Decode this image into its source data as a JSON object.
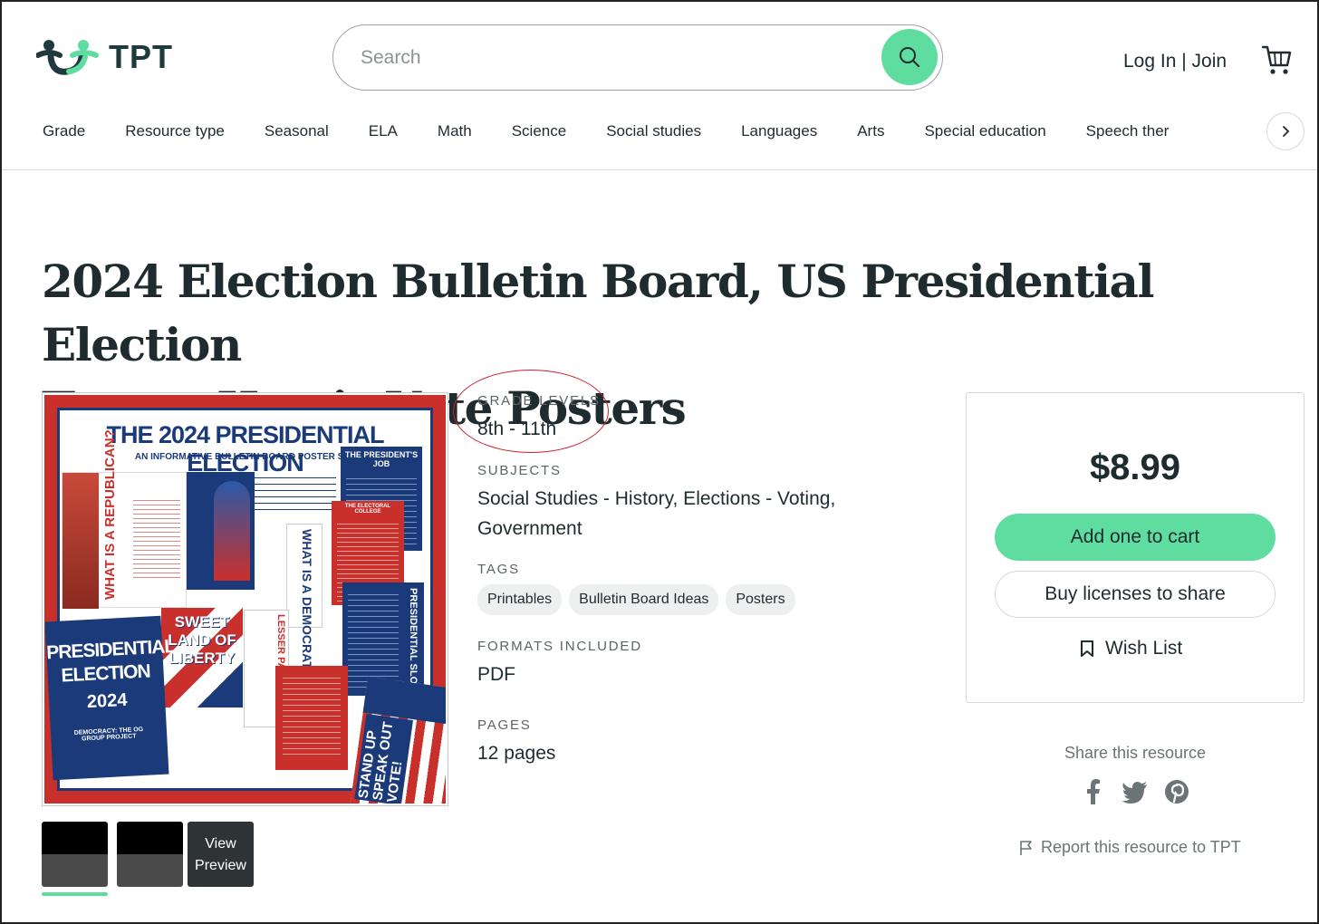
{
  "header": {
    "logo_text": "TPT",
    "search_placeholder": "Search",
    "login_label": "Log In",
    "separator": " | ",
    "join_label": "Join"
  },
  "nav": {
    "items": [
      "Grade",
      "Resource type",
      "Seasonal",
      "ELA",
      "Math",
      "Science",
      "Social studies",
      "Languages",
      "Arts",
      "Special education",
      "Speech ther"
    ]
  },
  "product": {
    "title_line1": "2024 Election Bulletin Board, US Presidential Election",
    "title_line2": "Trump Harris Vote Posters",
    "image": {
      "main_title": "THE 2024 PRESIDENTIAL ELECTION",
      "subtitle": "AN INFORMATIVE BULLETIN BOARD POSTER SET",
      "republican": "WHAT IS A REPUBLICAN?",
      "democrat": "WHAT IS A DEMOCRAT?",
      "presidents_job": "THE PRESIDENT'S JOB",
      "electoral_college": "THE ELECTORAL COLLEGE",
      "sweet_land": "SWEET LAND OF LIBERTY",
      "pres_election": "PRESIDENTIAL ELECTION",
      "year": "2024",
      "democracy": "DEMOCRACY: THE OG GROUP PROJECT",
      "lesser_parties": "LESSER PARTIES",
      "slogans": "PRESIDENTIAL SLOGANS",
      "stand_up": "STAND UP SPEAK OUT VOTE!"
    },
    "view_preview_line1": "View",
    "view_preview_line2": "Preview"
  },
  "details": {
    "grade_label": "GRADE LEVELS",
    "grade_value": "8th - 11th",
    "subjects_label": "SUBJECTS",
    "subjects_line1": "Social Studies - History, Elections - Voting,",
    "subjects_line2": "Government",
    "tags_label": "TAGS",
    "tags": [
      "Printables",
      "Bulletin Board Ideas",
      "Posters"
    ],
    "formats_label": "FORMATS INCLUDED",
    "formats_value": "PDF",
    "pages_label": "PAGES",
    "pages_value": "12 pages"
  },
  "buybox": {
    "price": "$8.99",
    "add_to_cart": "Add one to cart",
    "buy_licenses": "Buy licenses to share",
    "wish_list": "Wish List"
  },
  "share": {
    "label": "Share this resource",
    "icons": [
      "facebook-icon",
      "twitter-icon",
      "pinterest-icon"
    ],
    "report": "Report this resource to TPT"
  },
  "colors": {
    "accent": "#5fdca0",
    "annotation_circle": "#c8202a",
    "text": "#1e2b2f"
  }
}
